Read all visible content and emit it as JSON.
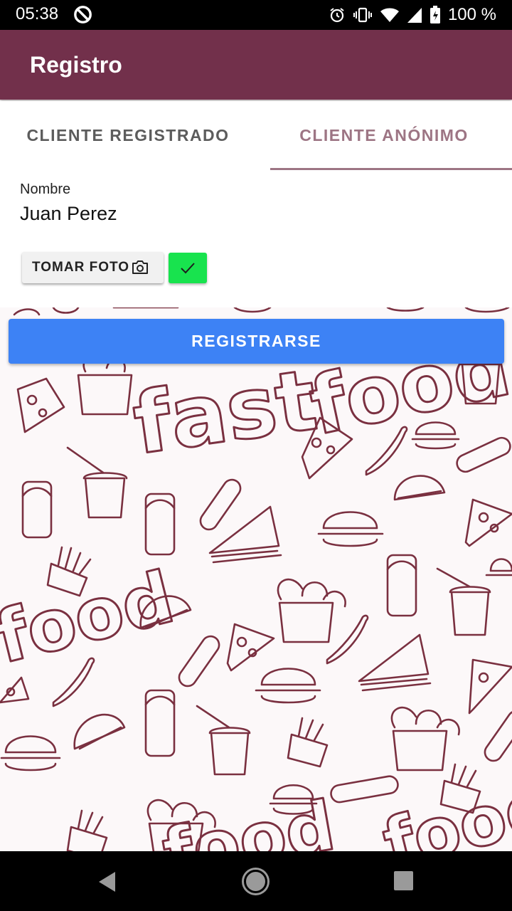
{
  "status_bar": {
    "time": "05:38",
    "battery": "100 %",
    "icons": [
      "at-sign-icon",
      "alarm-icon",
      "vibrate-icon",
      "wifi-icon",
      "signal-icon",
      "battery-icon"
    ]
  },
  "app_bar": {
    "title": "Registro",
    "color": "#72304b"
  },
  "tabs": [
    {
      "label": "CLIENTE REGISTRADO",
      "active": false
    },
    {
      "label": "CLIENTE ANÓNIMO",
      "active": true
    }
  ],
  "form": {
    "name_label": "Nombre",
    "name_value": "Juan Perez",
    "photo_button_label": "TOMAR FOTO",
    "photo_icon": "camera-icon",
    "photo_confirm_icon": "check-icon",
    "photo_confirm_color": "#18e34e"
  },
  "register_button": {
    "label": "REGISTRARSE",
    "color": "#3d82f5"
  },
  "background": {
    "pattern_words": [
      "fast",
      "food",
      "food",
      "food",
      "food"
    ],
    "pattern_icons": [
      "pizza-icon",
      "burger-icon",
      "fries-icon",
      "drink-icon",
      "taco-icon",
      "burrito-icon",
      "chicken-icon",
      "sandwich-icon",
      "hotdog-icon",
      "chili-icon"
    ]
  },
  "nav_bar": {
    "icons": [
      "back-icon",
      "home-icon",
      "recents-icon"
    ]
  }
}
